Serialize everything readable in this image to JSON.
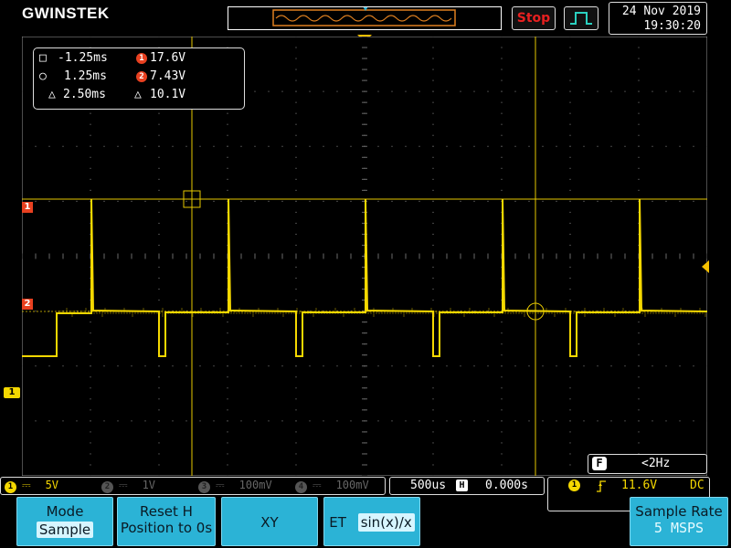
{
  "brand": "GWINSTEK",
  "run_state": "Stop",
  "datetime": {
    "date": "24 Nov 2019",
    "time": "19:30:20"
  },
  "cursors": {
    "h1": "-1.25ms",
    "h2": "1.25ms",
    "dh": "2.50ms",
    "v1": "17.6V",
    "v2": "7.43V",
    "dv": "10.1V",
    "h1_symbol": "□",
    "h2_symbol": "○",
    "delta_symbol": "△",
    "v1_badge": "1",
    "v2_badge": "2"
  },
  "markers": {
    "cursor1": "1",
    "cursor2": "2",
    "ch1": "1"
  },
  "freq_counter": {
    "badge": "F",
    "value": "<2Hz"
  },
  "channels": [
    {
      "num": "1",
      "coupling": "⎓",
      "scale": "5V",
      "color": "#f5d800",
      "active": true
    },
    {
      "num": "2",
      "coupling": "⎓",
      "scale": "1V",
      "color": "#555555",
      "active": false
    },
    {
      "num": "3",
      "coupling": "⎓",
      "scale": "100mV",
      "color": "#555555",
      "active": false
    },
    {
      "num": "4",
      "coupling": "⎓",
      "scale": "100mV",
      "color": "#555555",
      "active": false
    }
  ],
  "timebase": {
    "scale": "500us",
    "position_icon": "H",
    "position": "0.000s"
  },
  "trigger": {
    "source": "1",
    "slope": "rising",
    "level": "11.6V",
    "coupling": "DC"
  },
  "softkeys": {
    "mode_label": "Mode",
    "mode_value": "Sample",
    "reset_h_line1": "Reset H",
    "reset_h_line2": "Position to 0s",
    "xy_label": "XY",
    "et_label": "ET",
    "et_value": "sin(x)/x",
    "sample_rate_label": "Sample Rate",
    "sample_rate_value": "5 MSPS"
  },
  "colors": {
    "trace": "#f5d800",
    "cursor": "#e6c800",
    "grid": "#ffffff",
    "accent": "#e84020",
    "softkey": "#2bb3d6"
  }
}
